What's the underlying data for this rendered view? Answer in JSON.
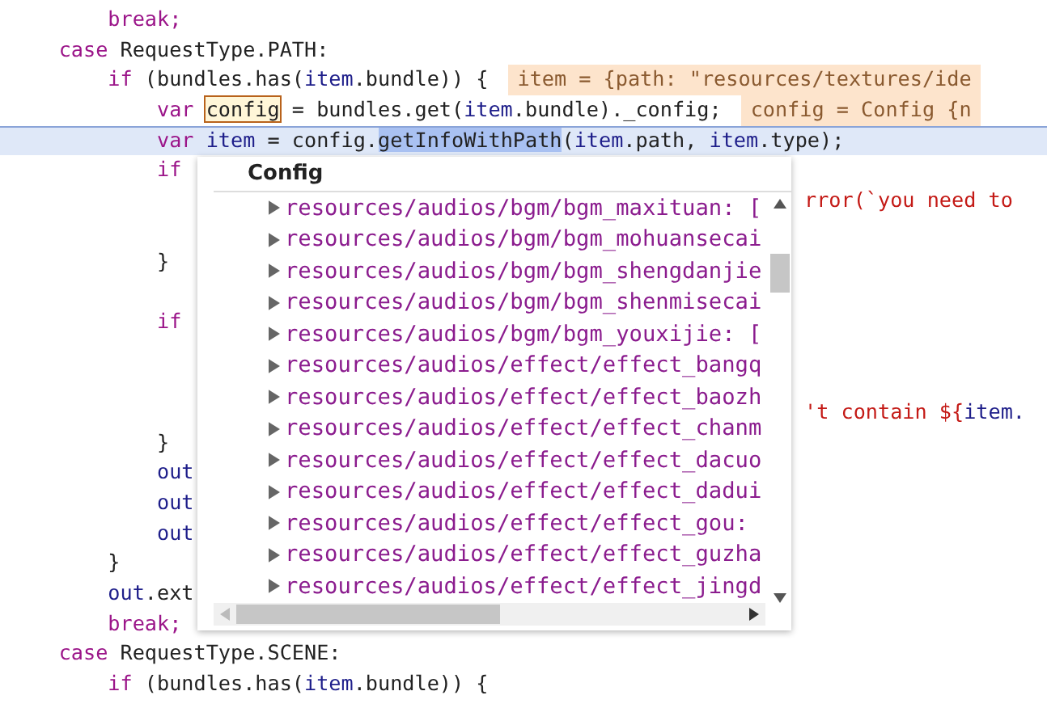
{
  "editor": {
    "lines": [
      {
        "kind": "code",
        "tokens": [
          {
            "text": "        break;",
            "kind": "keyword"
          }
        ]
      },
      {
        "kind": "code",
        "tokens": [
          {
            "text": "    case",
            "kind": "keyword"
          },
          {
            "text": " RequestType.PATH:",
            "kind": "plain"
          }
        ]
      },
      {
        "kind": "code",
        "tokens": [
          {
            "text": "        if",
            "kind": "keyword"
          },
          {
            "text": " (bundles.has(",
            "kind": "plain"
          },
          {
            "text": "item",
            "kind": "variable"
          },
          {
            "text": ".bundle)) {",
            "kind": "plain"
          }
        ],
        "hint": "item = {path: \"resources/textures/ide"
      },
      {
        "kind": "code",
        "tokens": [
          {
            "text": "            var ",
            "kind": "keyword"
          },
          {
            "text": "config",
            "kind": "found"
          },
          {
            "text": " = bundles.get(",
            "kind": "plain"
          },
          {
            "text": "item",
            "kind": "variable"
          },
          {
            "text": ".bundle)._config;",
            "kind": "plain"
          }
        ],
        "hint": "config = Config {n"
      },
      {
        "kind": "code",
        "current": true,
        "tokens": [
          {
            "text": "            var ",
            "kind": "keyword"
          },
          {
            "text": "item",
            "kind": "variable"
          },
          {
            "text": " = config.",
            "kind": "plain"
          },
          {
            "text": "getInfoWithPath",
            "kind": "selected"
          },
          {
            "text": "(",
            "kind": "plain"
          },
          {
            "text": "item",
            "kind": "variable"
          },
          {
            "text": ".path, ",
            "kind": "plain"
          },
          {
            "text": "item",
            "kind": "variable"
          },
          {
            "text": ".type);",
            "kind": "plain"
          }
        ]
      },
      {
        "kind": "code",
        "tokens": [
          {
            "text": "            if",
            "kind": "keyword"
          }
        ]
      },
      {
        "kind": "covered",
        "tokens": [
          {
            "text": "rror(`you need to",
            "kind": "string"
          }
        ]
      },
      {
        "kind": "blank"
      },
      {
        "kind": "code",
        "tokens": [
          {
            "text": "            }",
            "kind": "plain"
          }
        ]
      },
      {
        "kind": "blank"
      },
      {
        "kind": "code",
        "tokens": [
          {
            "text": "            if",
            "kind": "keyword"
          }
        ]
      },
      {
        "kind": "blank"
      },
      {
        "kind": "blank"
      },
      {
        "kind": "covered",
        "tokens": [
          {
            "text": "'t contain ${",
            "kind": "string"
          },
          {
            "text": "item.",
            "kind": "variable"
          }
        ]
      },
      {
        "kind": "code",
        "tokens": [
          {
            "text": "            }",
            "kind": "plain"
          }
        ]
      },
      {
        "kind": "code",
        "tokens": [
          {
            "text": "            out",
            "kind": "variable"
          }
        ]
      },
      {
        "kind": "code",
        "tokens": [
          {
            "text": "            out",
            "kind": "variable"
          }
        ]
      },
      {
        "kind": "code",
        "tokens": [
          {
            "text": "            out",
            "kind": "variable"
          }
        ]
      },
      {
        "kind": "code",
        "tokens": [
          {
            "text": "        }",
            "kind": "plain"
          }
        ]
      },
      {
        "kind": "code",
        "tokens": [
          {
            "text": "        out",
            "kind": "variable"
          },
          {
            "text": ".ext",
            "kind": "plain"
          }
        ]
      },
      {
        "kind": "code",
        "tokens": [
          {
            "text": "        break;",
            "kind": "keyword"
          }
        ]
      },
      {
        "kind": "code",
        "tokens": [
          {
            "text": "    case",
            "kind": "keyword"
          },
          {
            "text": " RequestType.SCENE:",
            "kind": "plain"
          }
        ]
      },
      {
        "kind": "code",
        "tokens": [
          {
            "text": "        if",
            "kind": "keyword"
          },
          {
            "text": " (bundles.has(",
            "kind": "plain"
          },
          {
            "text": "item",
            "kind": "variable"
          },
          {
            "text": ".bundle)) {",
            "kind": "plain"
          }
        ]
      }
    ]
  },
  "popup": {
    "title": "Config",
    "items": [
      {
        "text": "resources/audios/bgm/bgm_maxituan: [",
        "expanded": false
      },
      {
        "text": "resources/audios/bgm/bgm_mohuansecai",
        "expanded": false
      },
      {
        "text": "resources/audios/bgm/bgm_shengdanjie",
        "expanded": false
      },
      {
        "text": "resources/audios/bgm/bgm_shenmisecai",
        "expanded": false
      },
      {
        "text": "resources/audios/bgm/bgm_youxijie: [",
        "expanded": false
      },
      {
        "text": "resources/audios/effect/effect_bangq",
        "expanded": false
      },
      {
        "text": "resources/audios/effect/effect_baozh",
        "expanded": false
      },
      {
        "text": "resources/audios/effect/effect_chanm",
        "expanded": false
      },
      {
        "text": "resources/audios/effect/effect_dacuo",
        "expanded": false
      },
      {
        "text": "resources/audios/effect/effect_dadui",
        "expanded": false
      },
      {
        "text": "resources/audios/effect/effect_gou:",
        "expanded": false
      },
      {
        "text": "resources/audios/effect/effect_guzha",
        "expanded": false
      },
      {
        "text": "resources/audios/effect/effect_jingd",
        "expanded": false
      }
    ]
  }
}
